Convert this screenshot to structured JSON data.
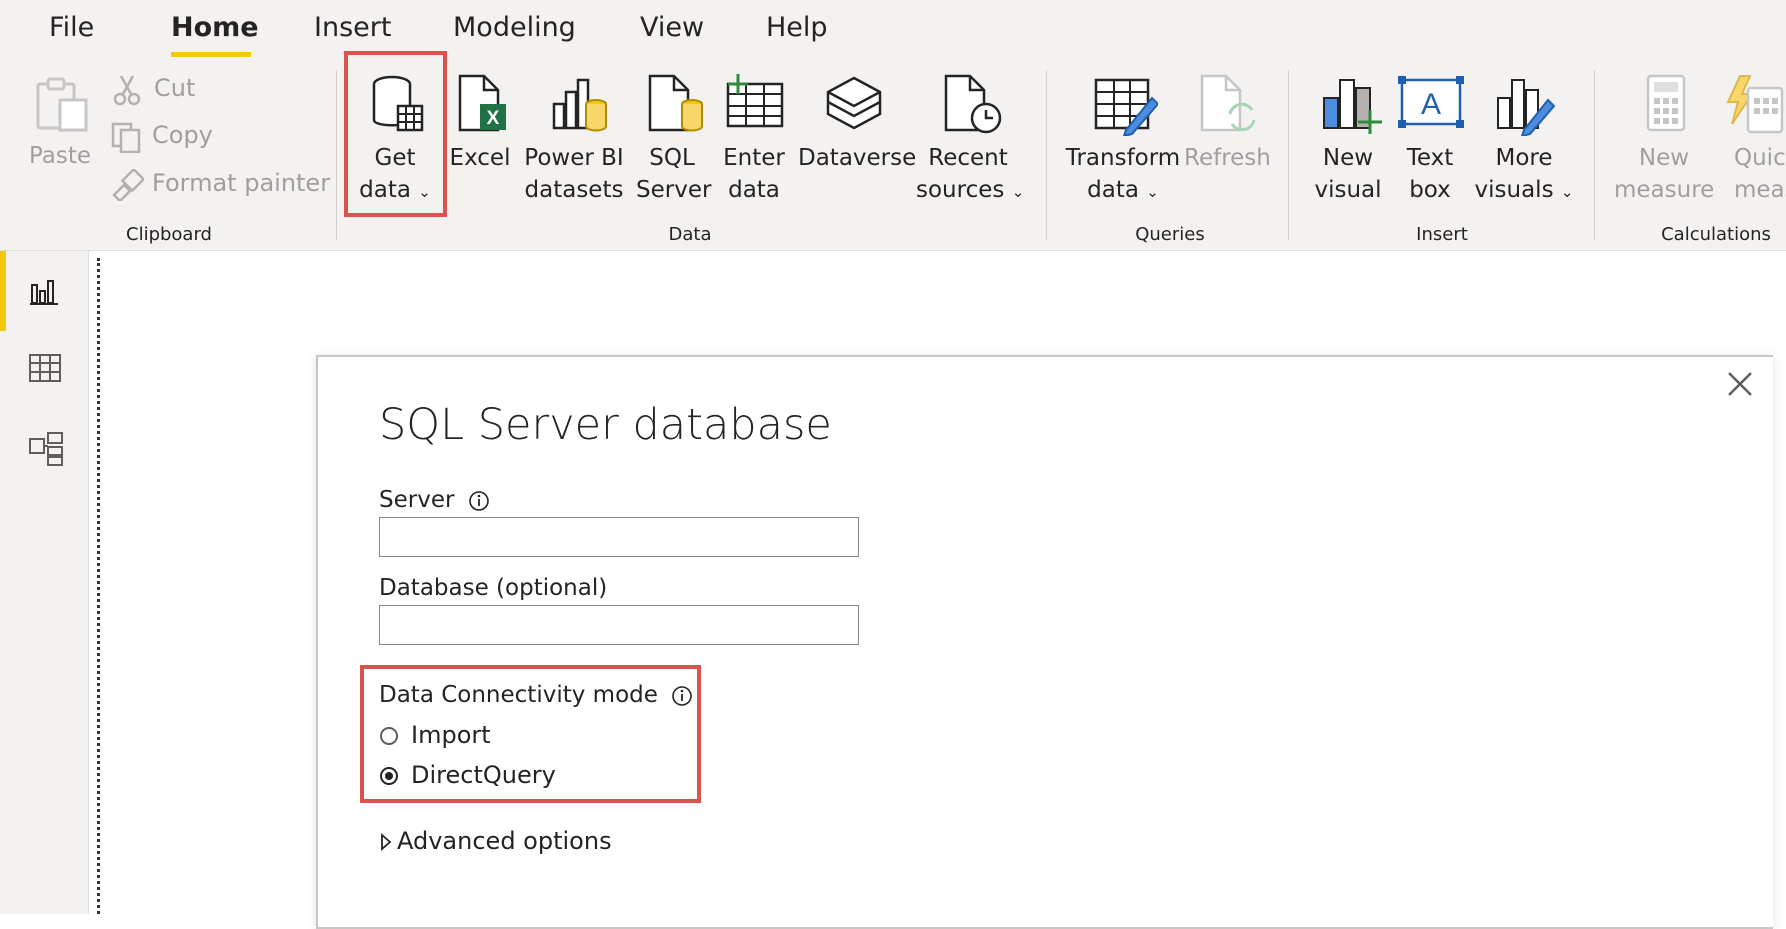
{
  "menu": {
    "tabs": [
      {
        "label": "File"
      },
      {
        "label": "Home"
      },
      {
        "label": "Insert"
      },
      {
        "label": "Modeling"
      },
      {
        "label": "View"
      },
      {
        "label": "Help"
      }
    ],
    "active_tab": "Home"
  },
  "ribbon": {
    "clipboard": {
      "paste": "Paste",
      "cut": "Cut",
      "copy": "Copy",
      "format_painter": "Format painter",
      "group_label": "Clipboard"
    },
    "data": {
      "get_data": {
        "line1": "Get",
        "line2": "data"
      },
      "excel": "Excel",
      "power_bi_datasets": {
        "line1": "Power BI",
        "line2": "datasets"
      },
      "sql_server": {
        "line1": "SQL",
        "line2": "Server"
      },
      "enter_data": {
        "line1": "Enter",
        "line2": "data"
      },
      "dataverse": "Dataverse",
      "recent_sources": {
        "line1": "Recent",
        "line2": "sources"
      },
      "group_label": "Data"
    },
    "queries": {
      "transform_data": {
        "line1": "Transform",
        "line2": "data"
      },
      "refresh": "Refresh",
      "group_label": "Queries"
    },
    "insert": {
      "new_visual": {
        "line1": "New",
        "line2": "visual"
      },
      "text_box": {
        "line1": "Text",
        "line2": "box"
      },
      "more_visuals": {
        "line1": "More",
        "line2": "visuals"
      },
      "group_label": "Insert"
    },
    "calculations": {
      "new_measure": {
        "line1": "New",
        "line2": "measure"
      },
      "quick_measure": {
        "line1": "Quic",
        "line2": "measu"
      },
      "group_label": "Calculations"
    }
  },
  "dialog": {
    "title": "SQL Server database",
    "server_label": "Server",
    "server_value": "",
    "database_label": "Database (optional)",
    "database_value": "",
    "connectivity_label": "Data Connectivity mode",
    "options": [
      {
        "label": "Import",
        "selected": false
      },
      {
        "label": "DirectQuery",
        "selected": true
      }
    ],
    "advanced_options": "Advanced options"
  },
  "colors": {
    "accent_yellow": "#f2c811",
    "highlight_red": "#d9534f",
    "ribbon_bg": "#f3f2f1",
    "excel_green": "#217346"
  }
}
